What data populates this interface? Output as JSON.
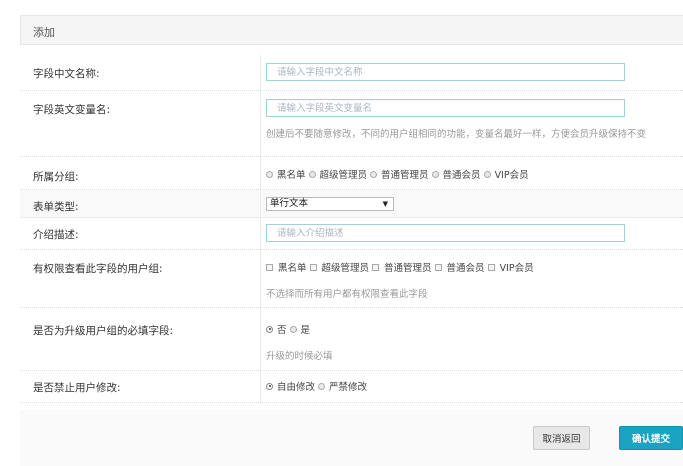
{
  "panel": {
    "title": "添加"
  },
  "fields": {
    "cn_name": {
      "label": "字段中文名称:",
      "placeholder": "请输入字段中文名称"
    },
    "en_name": {
      "label": "字段英文变量名:",
      "placeholder": "请输入字段英文变量名",
      "hint": "创建后不要随意修改，不同的用户组相同的功能，变量名最好一样，方便会员升级保持不变"
    },
    "group": {
      "label": "所属分组:",
      "options": [
        "黑名单",
        "超级管理员",
        "普通管理员",
        "普通会员",
        "VIP会员"
      ]
    },
    "form_type": {
      "label": "表单类型:",
      "selected": "单行文本"
    },
    "description": {
      "label": "介绍描述:",
      "placeholder": "请输入介绍描述"
    },
    "view_groups": {
      "label": "有权限查看此字段的用户组:",
      "options": [
        "黑名单",
        "超级管理员",
        "普通管理员",
        "普通会员",
        "VIP会员"
      ],
      "hint": "不选择而所有用户都有权限查看此字段"
    },
    "required_upgrade": {
      "label": "是否为升级用户组的必填字段:",
      "options": [
        "否",
        "是"
      ],
      "checked": 0,
      "hint": "升级的时候必填"
    },
    "forbid_edit": {
      "label": "是否禁止用户修改:",
      "options": [
        "自由修改",
        "严禁修改"
      ],
      "checked": 0
    }
  },
  "buttons": {
    "cancel": "取消返回",
    "submit": "确认提交"
  },
  "colors": {
    "submit_bg": "#1ba3c2",
    "input_border": "#9fd3d8"
  }
}
